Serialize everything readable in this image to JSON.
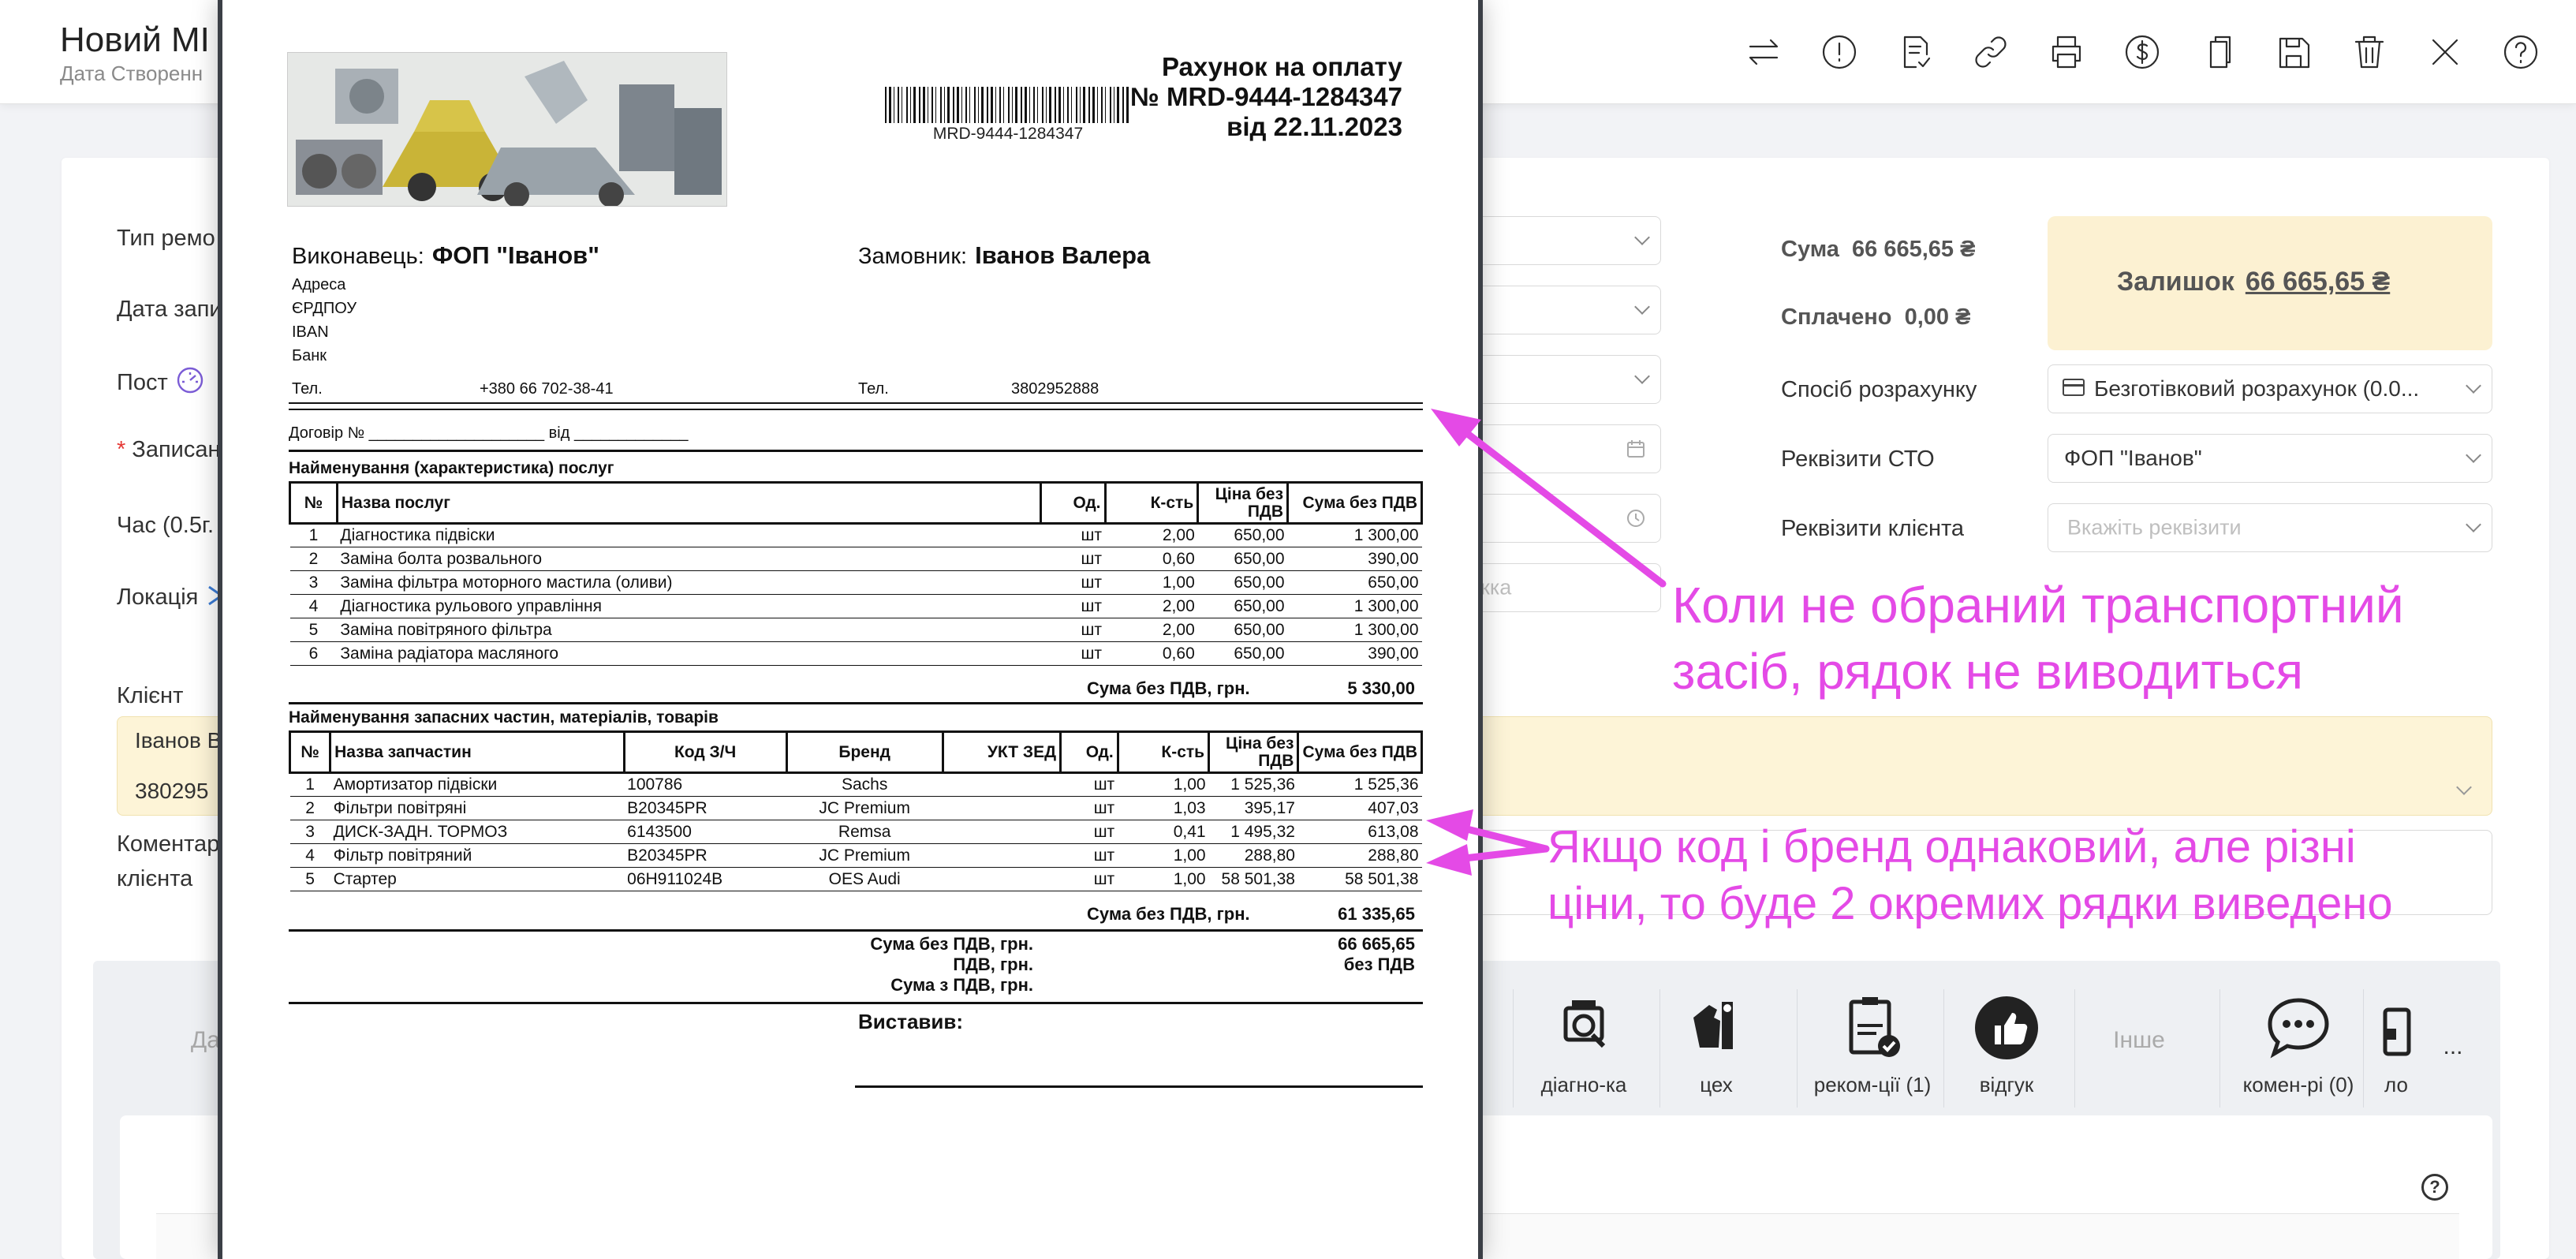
{
  "header": {
    "title": "Новий МІ",
    "subtitle": "Дата Створенн",
    "toolbar": [
      "swap-icon",
      "alert-icon",
      "document-check-icon",
      "link-icon",
      "printer-icon",
      "dollar-icon",
      "copy-icon",
      "save-icon",
      "trash-icon",
      "close-icon",
      "help-icon"
    ]
  },
  "form": {
    "labels": {
      "repair_type": "Тип ремо",
      "record_date": "Дата запи",
      "post": "Пост",
      "recorded": "Записан",
      "time": "Час (0.5г.",
      "location": "Локація",
      "client": "Клієнт",
      "comment1": "Коментар",
      "comment2": "клієнта",
      "req_mark": "*"
    },
    "placeholders": {
      "partial": "кка"
    },
    "client": {
      "name": "Іванов В",
      "phone": "380295"
    }
  },
  "finance": {
    "sum_label": "Сума",
    "sum_value": "66 665,65 ₴",
    "paid_label": "Сплачено",
    "paid_value": "0,00 ₴",
    "balance_label": "Залишок",
    "balance_value": "66 665,65 ₴",
    "payment_method_label": "Спосіб розрахунку",
    "payment_method_value": "Безготівковий розрахунок (0.0...",
    "sto_label": "Реквізити СТО",
    "sto_value": "ФОП \"Іванов\"",
    "client_req_label": "Реквізити клієнта",
    "client_req_placeholder": "Вкажіть реквізити"
  },
  "bottom_tabs": {
    "data": "Дані",
    "diagnostics": "діагно-ка",
    "shop": "цех",
    "recommendations": "реком-ції (1)",
    "feedback": "відгук",
    "other": "Інше",
    "comments": "комен-рі (0)",
    "partial": "ло",
    "more": "..."
  },
  "invoice": {
    "title": "Рахунок на оплату",
    "number": "№ MRD-9444-1284347",
    "date": "від 22.11.2023",
    "barcode_text": "MRD-9444-1284347",
    "executor_label": "Виконавець:",
    "executor": "ФОП \"Іванов\"",
    "customer_label": "Замовник:",
    "customer": "Іванов Валера",
    "addr_lines": [
      "Адреса",
      "ЄРДПОУ",
      "IBAN",
      "Банк"
    ],
    "tel_label": "Тел.",
    "executor_tel": "+380 66 702-38-41",
    "customer_tel": "3802952888",
    "contract": "Договір № ____________________ від _____________",
    "services_title": "Найменування (характеристика) послуг",
    "services_headers": [
      "№",
      "Назва послуг",
      "Од.",
      "К-сть",
      "Ціна без ПДВ",
      "Сума без ПДВ"
    ],
    "services": [
      [
        "1",
        "Діагностика підвіски",
        "шт",
        "2,00",
        "650,00",
        "1 300,00"
      ],
      [
        "2",
        "Заміна болта розвального",
        "шт",
        "0,60",
        "650,00",
        "390,00"
      ],
      [
        "3",
        "Заміна фільтра моторного мастила (оливи)",
        "шт",
        "1,00",
        "650,00",
        "650,00"
      ],
      [
        "4",
        "Діагностика рульового управління",
        "шт",
        "2,00",
        "650,00",
        "1 300,00"
      ],
      [
        "5",
        "Заміна повітряного фільтра",
        "шт",
        "2,00",
        "650,00",
        "1 300,00"
      ],
      [
        "6",
        "Заміна радіатора масляного",
        "шт",
        "0,60",
        "650,00",
        "390,00"
      ]
    ],
    "services_total_label": "Сума без ПДВ, грн.",
    "services_total": "5 330,00",
    "parts_title": "Найменування запасних частин, матеріалів, товарів",
    "parts_headers": [
      "№",
      "Назва запчастин",
      "Код З/Ч",
      "Бренд",
      "УКТ ЗЕД",
      "Од.",
      "К-сть",
      "Ціна без ПДВ",
      "Сума без ПДВ"
    ],
    "parts": [
      [
        "1",
        "Амортизатор підвіски",
        "100786",
        "Sachs",
        "",
        "шт",
        "1,00",
        "1 525,36",
        "1 525,36"
      ],
      [
        "2",
        "Фільтри повітряні",
        "B20345PR",
        "JC Premium",
        "",
        "шт",
        "1,03",
        "395,17",
        "407,03"
      ],
      [
        "3",
        "ДИСК-ЗАДН. ТОРМОЗ",
        "6143500",
        "Remsa",
        "",
        "шт",
        "0,41",
        "1 495,32",
        "613,08"
      ],
      [
        "4",
        "Фільтр повітряний",
        "B20345PR",
        "JC Premium",
        "",
        "шт",
        "1,00",
        "288,80",
        "288,80"
      ],
      [
        "5",
        "Стартер",
        "06H911024B",
        "OES Audi",
        "",
        "шт",
        "1,00",
        "58 501,38",
        "58 501,38"
      ]
    ],
    "parts_total_label": "Сума без ПДВ, грн.",
    "parts_total": "61 335,65",
    "grand_label": "Сума без ПДВ, грн.",
    "grand_value": "66 665,65",
    "vat_label": "ПДВ, грн.",
    "vat_value": "без ПДВ",
    "with_vat_label": "Сума з ПДВ, грн.",
    "issued_by": "Виставив:"
  },
  "annotations": {
    "top_line1": "Коли не обраний транспортний",
    "top_line2": "засіб, рядок не виводиться",
    "bottom_line1": "Якщо код і бренд однаковий, але різні",
    "bottom_line2": "ціни, то буде 2 окремих рядки виведено",
    "color": "#e44ae6"
  }
}
